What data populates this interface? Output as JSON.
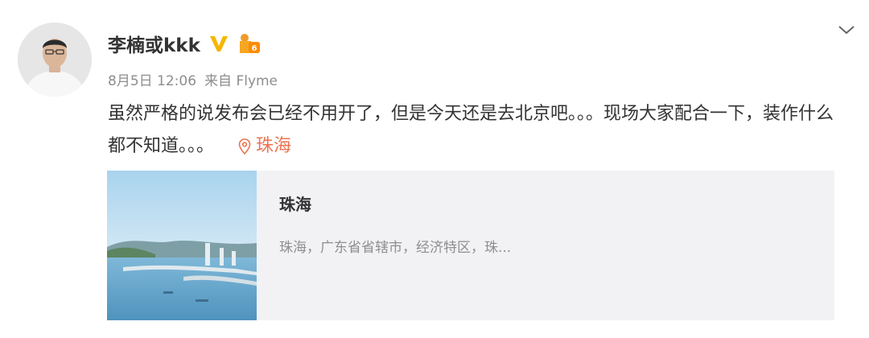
{
  "post": {
    "username": "李楠或kkk",
    "verified_icon": "verified-v-icon",
    "badge_icon": "vip-level-badge-icon",
    "dropdown_icon": "chevron-down-icon",
    "date": "8月5日 12:06",
    "source_prefix": "来自",
    "source": "Flyme",
    "text": "虽然严格的说发布会已经不用开了，但是今天还是去北京吧。。。现场大家配合一下，装作什么都不知道。。。",
    "location": "珠海",
    "location_icon": "location-pin-icon"
  },
  "card": {
    "thumbnail": "city-bridge-photo",
    "title": "珠海",
    "description": "珠海，广东省省辖市，经济特区，珠..."
  },
  "colors": {
    "accent": "#eb7350",
    "verified": "#f6b600",
    "text": "#333333",
    "meta": "#8e8e8e",
    "card_bg": "#f2f2f5"
  }
}
